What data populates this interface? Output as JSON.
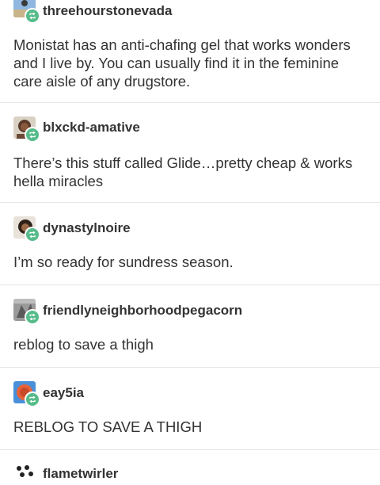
{
  "posts": [
    {
      "username": "threehourstonevada",
      "lines": [
        "Monistat has an anti-chafing gel that works wonders",
        "and I live by. You can usually find it in the feminine",
        "care aisle of any drugstore."
      ],
      "icons": [
        "avatar",
        "reblog-icon"
      ]
    },
    {
      "username": "blxckd-amative",
      "lines": [
        "There’s this stuff called Glide…pretty cheap & works",
        "hella miracles"
      ],
      "icons": [
        "avatar",
        "reblog-icon"
      ]
    },
    {
      "username": "dynastylnoire",
      "lines": [
        "I’m so ready for sundress season."
      ],
      "icons": [
        "avatar",
        "reblog-icon"
      ]
    },
    {
      "username": "friendlyneighborhoodpegacorn",
      "lines": [
        "reblog to save a thigh"
      ],
      "icons": [
        "avatar",
        "reblog-icon"
      ]
    },
    {
      "username": "eay5ia",
      "lines": [
        "REBLOG TO SAVE A THIGH"
      ],
      "icons": [
        "avatar",
        "reblog-icon"
      ]
    },
    {
      "username": "flametwirler",
      "lines": [],
      "icons": [
        "avatar"
      ]
    }
  ],
  "colors": {
    "text": "#333333",
    "divider": "#e6e6e6",
    "reblog_badge": "#56bc8a",
    "avatar_eay5ia_bg": "#4a90d9",
    "avatar_eay5ia_ring": "#e8623a"
  }
}
